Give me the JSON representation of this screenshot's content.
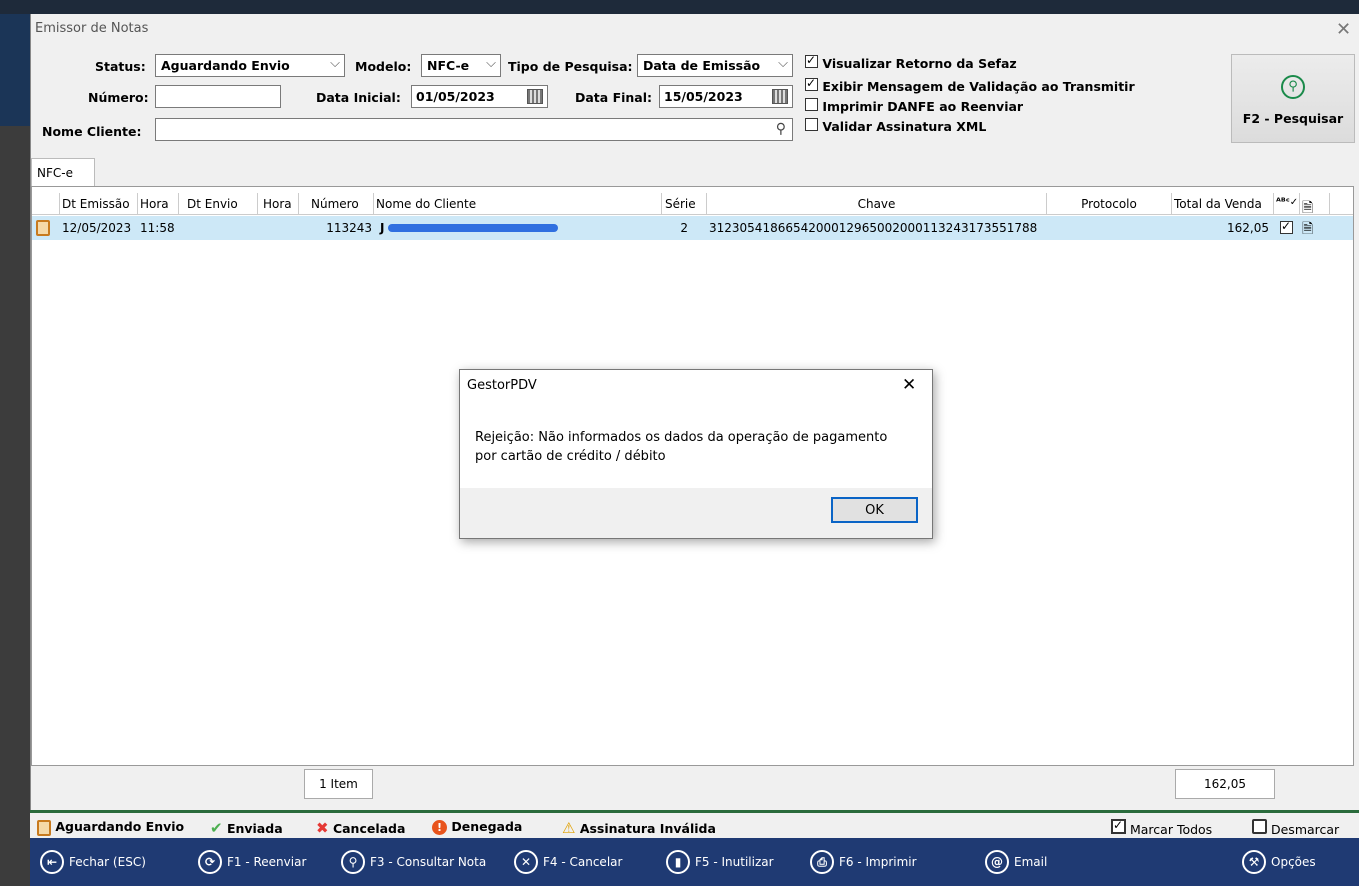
{
  "window": {
    "title": "Emissor de Notas"
  },
  "filters": {
    "status_label": "Status:",
    "status_value": "Aguardando Envio",
    "modelo_label": "Modelo:",
    "modelo_value": "NFC-e",
    "tipo_label": "Tipo de Pesquisa:",
    "tipo_value": "Data de Emissão",
    "numero_label": "Número:",
    "numero_value": "",
    "data_inicial_label": "Data Inicial:",
    "data_inicial_value": "01/05/2023",
    "data_final_label": "Data Final:",
    "data_final_value": "15/05/2023",
    "nome_cliente_label": "Nome Cliente:",
    "nome_cliente_value": ""
  },
  "options": [
    {
      "label": "Visualizar Retorno da Sefaz",
      "checked": true
    },
    {
      "label": "Exibir Mensagem de Validação ao Transmitir",
      "checked": true
    },
    {
      "label": "Imprimir DANFE ao Reenviar",
      "checked": false
    },
    {
      "label": "Validar Assinatura XML",
      "checked": false
    }
  ],
  "search_button": {
    "label": "F2 - Pesquisar"
  },
  "tab": {
    "label": "NFC-e"
  },
  "columns": [
    "Dt Emissão",
    "Hora",
    "Dt Envio",
    "Hora",
    "Número",
    "Nome do Cliente",
    "Série",
    "Chave",
    "Protocolo",
    "Total da Venda"
  ],
  "rows": [
    {
      "dt_emissao": "12/05/2023",
      "hora": "11:58",
      "dt_envio": "",
      "hora_envio": "",
      "numero": "113243",
      "cliente": "J",
      "serie": "2",
      "chave": "31230541866542000129650020001132431735517‌88",
      "protocolo": "",
      "total": "162,05"
    }
  ],
  "footer": {
    "items_count": "1 Item",
    "total": "162,05"
  },
  "legend": [
    {
      "label": "Aguardando Envio",
      "icon": "hourglass-icon",
      "color": "#c87a1e"
    },
    {
      "label": "Enviada",
      "icon": "check-icon",
      "color": "#4caf50"
    },
    {
      "label": "Cancelada",
      "icon": "x-icon",
      "color": "#e53935"
    },
    {
      "label": "Denegada",
      "icon": "exclamation-icon",
      "color": "#e8541c"
    },
    {
      "label": "Assinatura Inválida",
      "icon": "warning-icon",
      "color": "#e0a000"
    }
  ],
  "selection": {
    "mark_all": "Marcar Todos",
    "unmark": "Desmarcar"
  },
  "toolbar": [
    {
      "label": "Fechar (ESC)",
      "icon": "exit-icon"
    },
    {
      "label": "F1 - Reenviar",
      "icon": "resend-icon"
    },
    {
      "label": "F3 - Consultar Nota",
      "icon": "search-icon"
    },
    {
      "label": "F4 - Cancelar",
      "icon": "cancel-icon"
    },
    {
      "label": "F5 - Inutilizar",
      "icon": "trash-icon"
    },
    {
      "label": "F6 - Imprimir",
      "icon": "printer-icon"
    },
    {
      "label": "Email",
      "icon": "email-icon"
    },
    {
      "label": "Opções",
      "icon": "tools-icon"
    }
  ],
  "dialog": {
    "title": "GestorPDV",
    "message_line1": "Rejeição: Não informados os dados da operação de pagamento",
    "message_line2": "por cartão de crédito / débito",
    "ok_label": "OK"
  }
}
